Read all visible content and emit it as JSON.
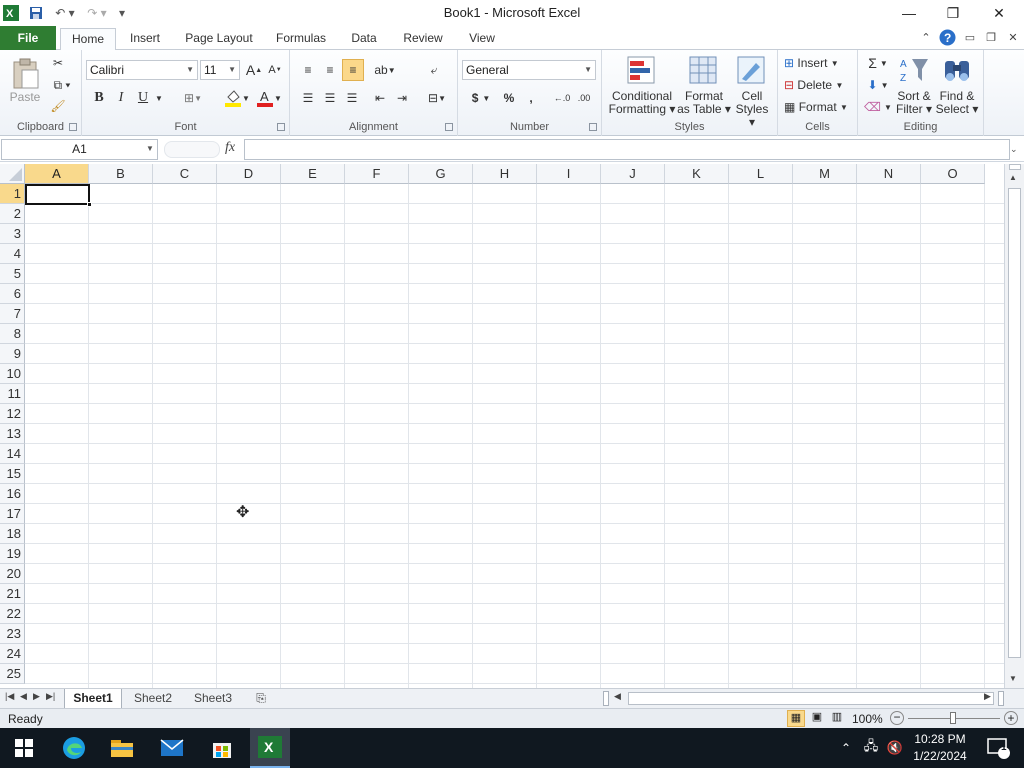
{
  "window": {
    "title": "Book1 - Microsoft Excel"
  },
  "ribbon": {
    "tabs": [
      "File",
      "Home",
      "Insert",
      "Page Layout",
      "Formulas",
      "Data",
      "Review",
      "View"
    ],
    "active_tab": "Home",
    "clipboard": {
      "paste": "Paste",
      "label": "Clipboard"
    },
    "font": {
      "name": "Calibri",
      "size": "11",
      "bold": "B",
      "italic": "I",
      "underline": "U",
      "label": "Font"
    },
    "alignment": {
      "label": "Alignment"
    },
    "number": {
      "format": "General",
      "currency": "$",
      "percent": "%",
      "comma": ",",
      "label": "Number"
    },
    "styles": {
      "conditional": "Conditional",
      "conditional2": "Formatting",
      "format_table": "Format",
      "format_table2": "as Table",
      "cell_styles": "Cell",
      "cell_styles2": "Styles",
      "label": "Styles"
    },
    "cells": {
      "insert": "Insert",
      "delete": "Delete",
      "format": "Format",
      "label": "Cells"
    },
    "editing": {
      "sum": "Σ",
      "sort": "Sort &",
      "sort2": "Filter",
      "find": "Find &",
      "find2": "Select",
      "label": "Editing"
    }
  },
  "formula_bar": {
    "name_box": "A1",
    "fx": "fx",
    "value": ""
  },
  "grid": {
    "columns": [
      "A",
      "B",
      "C",
      "D",
      "E",
      "F",
      "G",
      "H",
      "I",
      "J",
      "K",
      "L",
      "M",
      "N",
      "O"
    ],
    "rows": [
      "1",
      "2",
      "3",
      "4",
      "5",
      "6",
      "7",
      "8",
      "9",
      "10",
      "11",
      "12",
      "13",
      "14",
      "15",
      "16",
      "17",
      "18",
      "19",
      "20",
      "21",
      "22",
      "23",
      "24",
      "25"
    ],
    "selected_cell": "A1"
  },
  "sheets": {
    "tabs": [
      "Sheet1",
      "Sheet2",
      "Sheet3"
    ],
    "active": "Sheet1"
  },
  "status": {
    "text": "Ready",
    "zoom": "100%"
  },
  "taskbar": {
    "time": "10:28 PM",
    "date": "1/22/2024",
    "notifications": "1"
  },
  "colors": {
    "file_tab": "#2f7d32",
    "selected_header": "#f9d98c",
    "taskbar": "#101820"
  }
}
